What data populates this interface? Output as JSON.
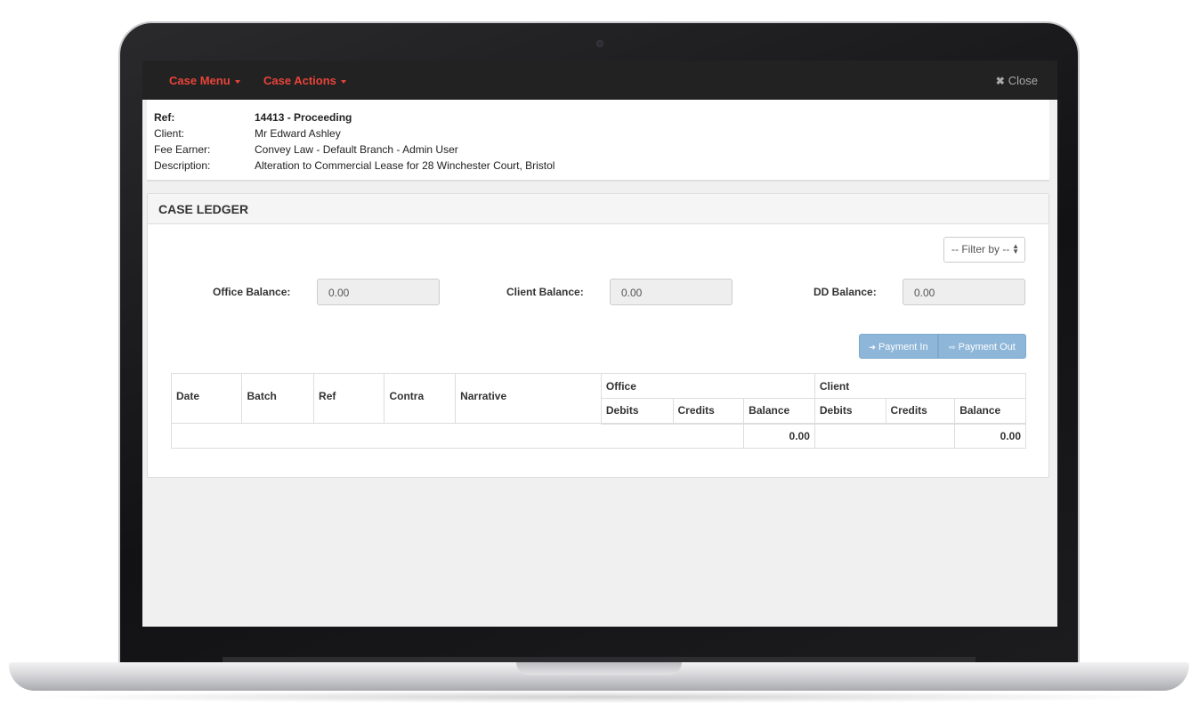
{
  "nav": {
    "case_menu": "Case Menu",
    "case_actions": "Case Actions",
    "close": "Close"
  },
  "case_info": {
    "ref_label": "Ref:",
    "ref_value": "14413 - Proceeding",
    "client_label": "Client:",
    "client_value": "Mr Edward Ashley",
    "fee_earner_label": "Fee Earner:",
    "fee_earner_value": "Convey Law - Default Branch - Admin User",
    "description_label": "Description:",
    "description_value": "Alteration to Commercial Lease for 28 Winchester Court, Bristol"
  },
  "ledger": {
    "title": "CASE LEDGER",
    "filter_placeholder": "-- Filter by --",
    "office_balance_label": "Office Balance:",
    "office_balance_value": "0.00",
    "client_balance_label": "Client Balance:",
    "client_balance_value": "0.00",
    "dd_balance_label": "DD Balance:",
    "dd_balance_value": "0.00",
    "payment_in": "Payment In",
    "payment_out": "Payment Out",
    "group_office": "Office",
    "group_client": "Client",
    "columns": {
      "date": "Date",
      "batch": "Batch",
      "ref": "Ref",
      "contra": "Contra",
      "narrative": "Narrative",
      "office_debits": "Debits",
      "office_credits": "Credits",
      "office_balance": "Balance",
      "client_debits": "Debits",
      "client_credits": "Credits",
      "client_balance": "Balance"
    },
    "totals": {
      "office_balance": "0.00",
      "client_balance": "0.00"
    }
  },
  "colors": {
    "navbar_bg": "#222222",
    "nav_accent": "#e8443a",
    "button_primary": "#8db6d9"
  }
}
